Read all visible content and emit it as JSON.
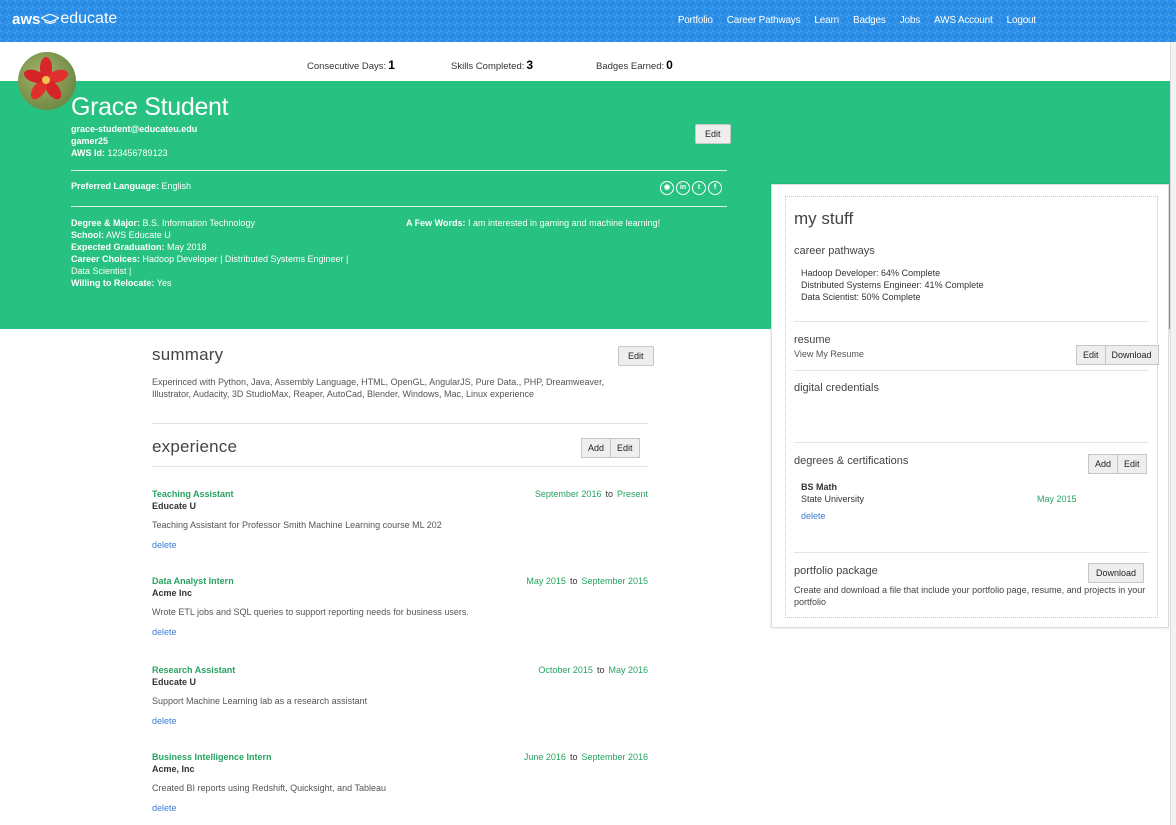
{
  "brand": {
    "aws": "aws",
    "educate": "educate"
  },
  "nav": [
    "Portfolio",
    "Career Pathways",
    "Learn",
    "Badges",
    "Jobs",
    "AWS Account",
    "Logout"
  ],
  "stats": {
    "days_label": "Consecutive Days:",
    "days": "1",
    "skills_label": "Skills Completed:",
    "skills": "3",
    "badges_label": "Badges Earned:",
    "badges": "0"
  },
  "profile": {
    "name": "Grace Student",
    "email": "grace-student@educateu.edu",
    "username": "gamer25",
    "aws_id_label": "AWS Id:",
    "aws_id": "123456789123",
    "edit": "Edit",
    "pref_lang_label": "Preferred Language:",
    "pref_lang": "English",
    "degree_label": "Degree & Major:",
    "degree": "B.S. Information Technology",
    "school_label": "School:",
    "school": "AWS Educate U",
    "grad_label": "Expected Graduation:",
    "grad": "May 2018",
    "career_label": "Career Choices:",
    "career": "Hadoop Developer | Distributed Systems Engineer | Data Scientist |",
    "relocate_label": "Willing to Relocate:",
    "relocate": "Yes",
    "words_label": "A Few Words:",
    "words": "I am interested in gaming and machine learning!",
    "social": [
      "github-icon",
      "linkedin-icon",
      "twitter-icon",
      "facebook-icon"
    ]
  },
  "summary": {
    "title": "summary",
    "edit": "Edit",
    "text": "Experinced with Python, Java, Assembly Language, HTML, OpenGL, AngularJS, Pure Data., PHP, Dreamweaver, Illustrator, Audacity, 3D StudioMax, Reaper, AutoCad, Blender, Windows, Mac, Linux experience"
  },
  "experience": {
    "title": "experience",
    "add": "Add",
    "edit": "Edit",
    "to": "to",
    "delete": "delete",
    "items": [
      {
        "title": "Teaching Assistant",
        "org": "Educate U",
        "from": "September 2016",
        "until": "Present",
        "desc": "Teaching Assistant for Professor Smith Machine Learning course ML 202"
      },
      {
        "title": "Data Analyst Intern",
        "org": "Acme Inc",
        "from": "May 2015",
        "until": "September 2015",
        "desc": "Wrote ETL jobs and SQL queries to support reporting needs for business users."
      },
      {
        "title": "Research Assistant",
        "org": "Educate U",
        "from": "October 2015",
        "until": "May 2016",
        "desc": "Support Machine Learning lab as a research assistant"
      },
      {
        "title": "Business Intelligence Intern",
        "org": "Acme, Inc",
        "from": "June 2016",
        "until": "September 2016",
        "desc": "Created BI reports using Redshift, Quicksight, and Tableau"
      }
    ]
  },
  "mystuff": {
    "title": "my stuff",
    "pathways_title": "career pathways",
    "pathways": [
      "Hadoop Developer: 64% Complete",
      "Distributed Systems Engineer: 41% Complete",
      "Data Scientist: 50% Complete"
    ],
    "resume_title": "resume",
    "resume_link": "View My Resume",
    "resume_edit": "Edit",
    "resume_download": "Download",
    "credentials_title": "digital credentials",
    "degrees_title": "degrees & certifications",
    "degrees_add": "Add",
    "degrees_edit": "Edit",
    "degree_name": "BS Math",
    "degree_school": "State University",
    "degree_date": "May 2015",
    "degree_delete": "delete",
    "portfolio_title": "portfolio package",
    "portfolio_download": "Download",
    "portfolio_text": "Create and download a file that include your portfolio page, resume, and projects in your portfolio"
  }
}
